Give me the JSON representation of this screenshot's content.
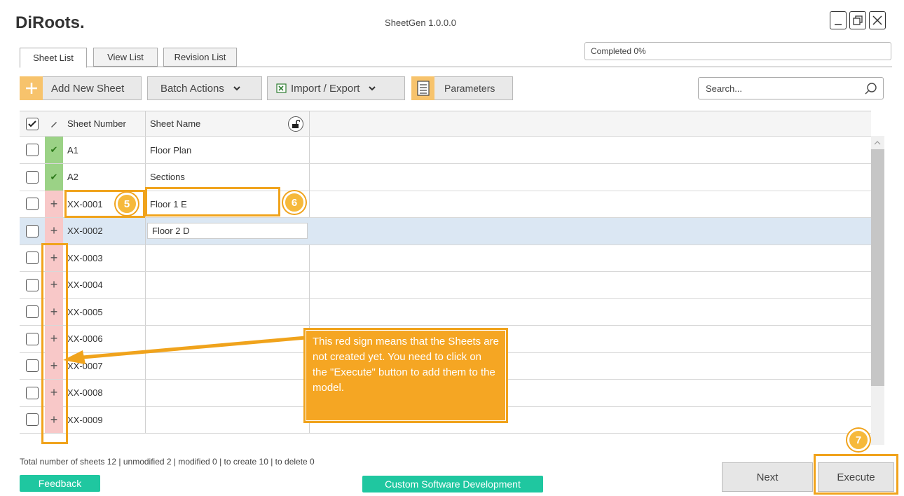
{
  "app": {
    "logo": "DiRoots.",
    "title": "SheetGen 1.0.0.0"
  },
  "window_controls": {
    "minimize_icon": "minimize-icon",
    "restore_icon": "restore-icon",
    "close_icon": "close-icon"
  },
  "tabs": [
    {
      "label": "Sheet List",
      "active": true
    },
    {
      "label": "View List",
      "active": false
    },
    {
      "label": "Revision List",
      "active": false
    }
  ],
  "progress": {
    "text": "Completed 0%"
  },
  "toolbar": {
    "add_label": "Add New Sheet",
    "batch_label": "Batch Actions",
    "import_label": "Import / Export",
    "parameters_label": "Parameters"
  },
  "search": {
    "placeholder": "Search..."
  },
  "grid": {
    "headers": {
      "number": "Sheet Number",
      "name": "Sheet Name"
    },
    "rows": [
      {
        "number": "A1",
        "name": "Floor Plan",
        "status": "unmodified"
      },
      {
        "number": "A2",
        "name": "Sections",
        "status": "unmodified"
      },
      {
        "number": "XX-0001",
        "name": "Floor 1 E",
        "status": "to-create"
      },
      {
        "number": "XX-0002",
        "name": "Floor 2 D",
        "status": "to-create"
      },
      {
        "number": "XX-0003",
        "name": "",
        "status": "to-create"
      },
      {
        "number": "XX-0004",
        "name": "",
        "status": "to-create"
      },
      {
        "number": "XX-0005",
        "name": "",
        "status": "to-create"
      },
      {
        "number": "XX-0006",
        "name": "",
        "status": "to-create"
      },
      {
        "number": "XX-0007",
        "name": "",
        "status": "to-create"
      },
      {
        "number": "XX-0008",
        "name": "",
        "status": "to-create"
      },
      {
        "number": "XX-0009",
        "name": "",
        "status": "to-create"
      }
    ]
  },
  "annotations": {
    "badge5": "5",
    "badge6": "6",
    "badge7": "7",
    "callout": "This red sign means that the Sheets are not created yet. You need to click on the \"Execute\" button to add them to the model."
  },
  "footer": {
    "stats": "Total number of sheets 12 | unmodified 2 | modified 0 | to create 10 | to delete 0",
    "feedback_label": "Feedback",
    "custom_label": "Custom Software Development",
    "next_label": "Next",
    "execute_label": "Execute"
  },
  "colors": {
    "accent": "#f0a31c",
    "green_status": "#9bd286",
    "red_status": "#f8c8c8",
    "teal_button": "#1fc7a0"
  }
}
